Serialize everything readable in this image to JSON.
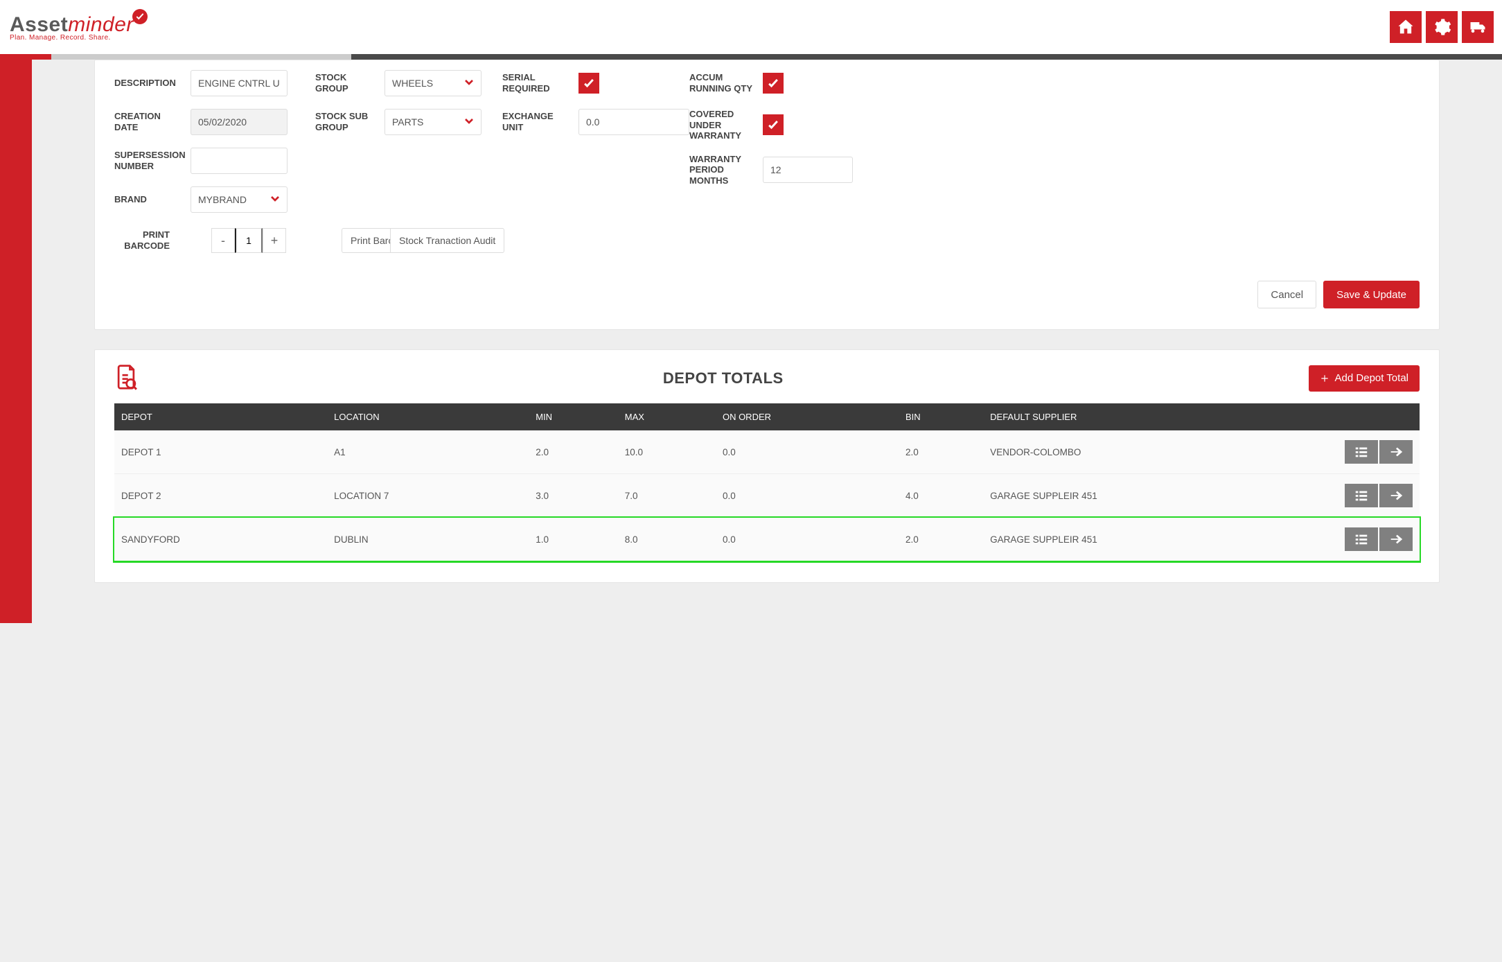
{
  "logo": {
    "part1": "Asset",
    "part2": "minder",
    "tagline": "Plan. Manage. Record. Share."
  },
  "form": {
    "description": {
      "label": "DESCRIPTION",
      "value": "ENGINE CNTRL UN"
    },
    "creation_date": {
      "label": "CREATION DATE",
      "value": "05/02/2020"
    },
    "supersession": {
      "label": "SUPERSESSION NUMBER",
      "value": ""
    },
    "brand": {
      "label": "BRAND",
      "value": "MYBRAND"
    },
    "stock_group": {
      "label": "STOCK GROUP",
      "value": "WHEELS"
    },
    "stock_sub_group": {
      "label": "STOCK SUB GROUP",
      "value": "PARTS"
    },
    "serial_required": {
      "label": "SERIAL REQUIRED"
    },
    "exchange_unit": {
      "label": "EXCHANGE UNIT",
      "value": "0.0"
    },
    "accum_running": {
      "label": "ACCUM RUNNING QTY"
    },
    "covered_warranty": {
      "label": "COVERED UNDER WARRANTY"
    },
    "warranty_period": {
      "label": "WARRANTY PERIOD MONTHS",
      "value": "12"
    },
    "print_barcode": {
      "label": "PRINT BARCODE",
      "qty": "1"
    },
    "buttons": {
      "print_barcode": "Print Barc",
      "stock_audit": "Stock Tranaction Audit",
      "cancel": "Cancel",
      "save": "Save & Update"
    }
  },
  "depot": {
    "title": "DEPOT TOTALS",
    "add_label": "Add Depot Total",
    "columns": [
      "DEPOT",
      "LOCATION",
      "MIN",
      "MAX",
      "ON ORDER",
      "BIN",
      "DEFAULT SUPPLIER"
    ],
    "rows": [
      {
        "depot": "DEPOT 1",
        "location": "A1",
        "min": "2.0",
        "max": "10.0",
        "on_order": "0.0",
        "bin": "2.0",
        "supplier": "VENDOR-COLOMBO",
        "highlight": false
      },
      {
        "depot": "DEPOT 2",
        "location": "LOCATION 7",
        "min": "3.0",
        "max": "7.0",
        "on_order": "0.0",
        "bin": "4.0",
        "supplier": "GARAGE SUPPLEIR 451",
        "highlight": false
      },
      {
        "depot": "SANDYFORD",
        "location": "DUBLIN",
        "min": "1.0",
        "max": "8.0",
        "on_order": "0.0",
        "bin": "2.0",
        "supplier": "GARAGE SUPPLEIR 451",
        "highlight": true
      }
    ]
  }
}
